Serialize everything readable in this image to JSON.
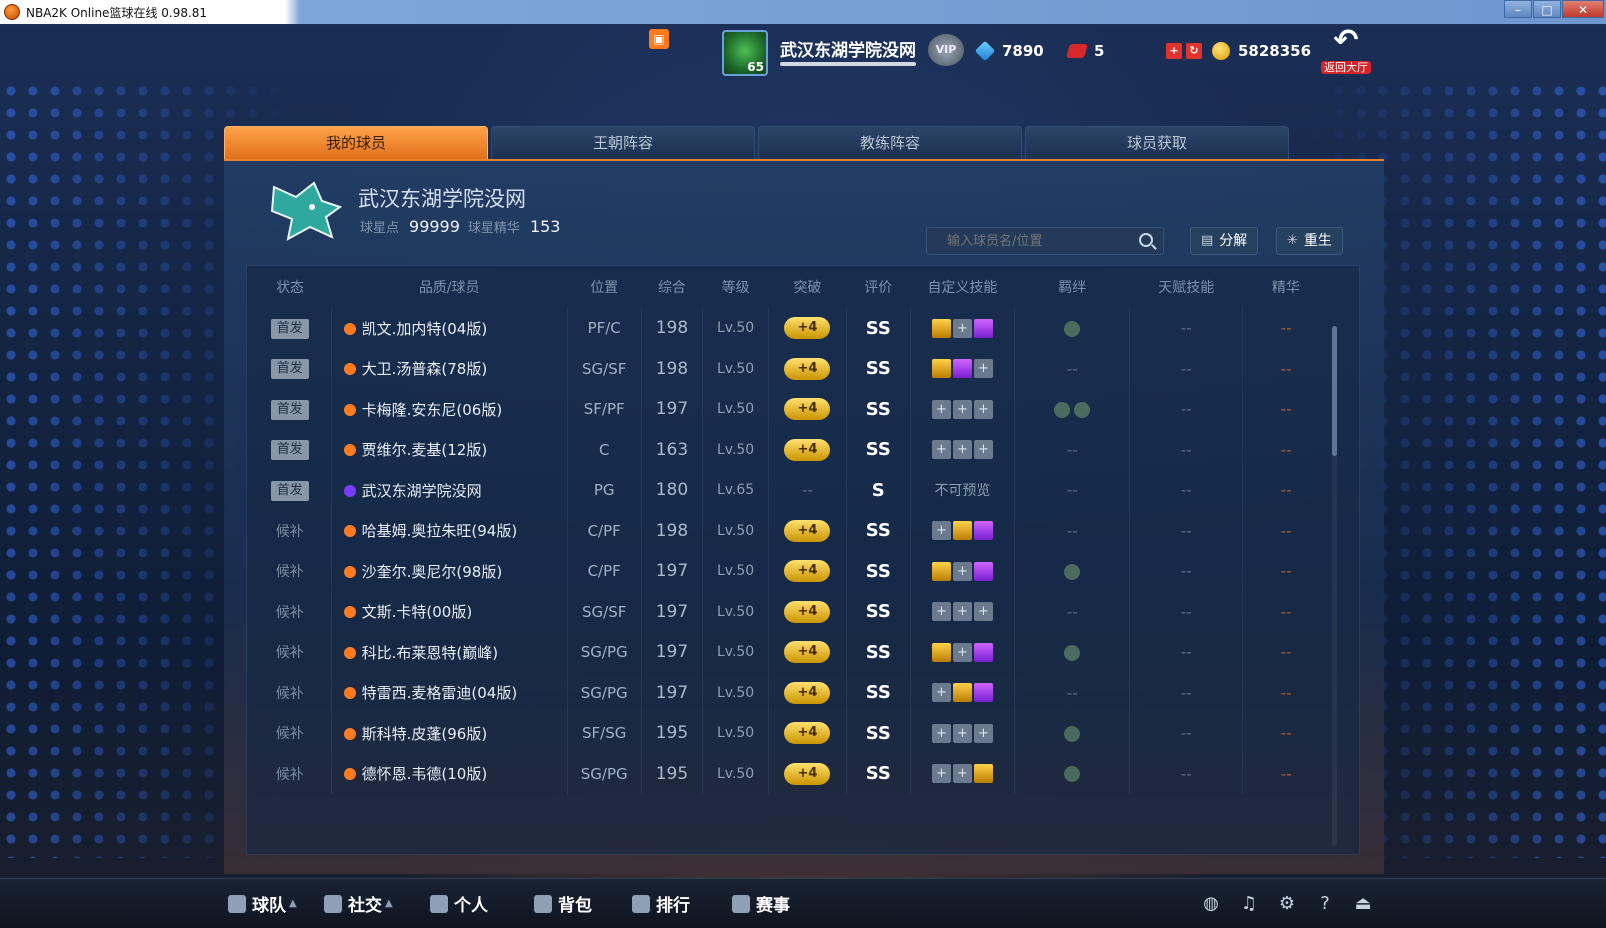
{
  "window": {
    "title": "NBA2K Online篮球在线 0.98.81"
  },
  "header": {
    "avatar_level": "65",
    "username": "武汉东湖学院没网",
    "vip_label": "VIP",
    "diamonds": "7890",
    "tickets": "5",
    "coins": "5828356",
    "back_label": "返回大厅"
  },
  "tabs": [
    "我的球员",
    "王朝阵容",
    "教练阵容",
    "球员获取"
  ],
  "team": {
    "name": "武汉东湖学院没网",
    "star_points_label": "球星点",
    "star_points": "99999",
    "essence_label": "球星精华",
    "essence": "153"
  },
  "search": {
    "placeholder": "输入球员名/位置"
  },
  "buttons": {
    "decompose": "分解",
    "rebirth": "重生"
  },
  "table": {
    "headers": [
      "状态",
      "品质/球员",
      "位置",
      "综合",
      "等级",
      "突破",
      "评价",
      "自定义技能",
      "羁绊",
      "天赋技能",
      "精华"
    ],
    "rows": [
      {
        "status": "首发",
        "name": "凯文.加内特(04版)",
        "pos": "PF/C",
        "ovr": "198",
        "lv": "Lv.50",
        "bt": "+4",
        "grade": "SS"
      },
      {
        "status": "首发",
        "name": "大卫.汤普森(78版)",
        "pos": "SG/SF",
        "ovr": "198",
        "lv": "Lv.50",
        "bt": "+4",
        "grade": "SS"
      },
      {
        "status": "首发",
        "name": "卡梅隆.安东尼(06版)",
        "pos": "SF/PF",
        "ovr": "197",
        "lv": "Lv.50",
        "bt": "+4",
        "grade": "SS"
      },
      {
        "status": "首发",
        "name": "贾维尔.麦基(12版)",
        "pos": "C",
        "ovr": "163",
        "lv": "Lv.50",
        "bt": "+4",
        "grade": "SS"
      },
      {
        "status": "首发",
        "name": "武汉东湖学院没网",
        "pos": "PG",
        "ovr": "180",
        "lv": "Lv.65",
        "bt": "--",
        "grade": "S",
        "skills_text": "不可预览"
      },
      {
        "status": "候补",
        "name": "哈基姆.奥拉朱旺(94版)",
        "pos": "C/PF",
        "ovr": "198",
        "lv": "Lv.50",
        "bt": "+4",
        "grade": "SS"
      },
      {
        "status": "候补",
        "name": "沙奎尔.奥尼尔(98版)",
        "pos": "C/PF",
        "ovr": "197",
        "lv": "Lv.50",
        "bt": "+4",
        "grade": "SS"
      },
      {
        "status": "候补",
        "name": "文斯.卡特(00版)",
        "pos": "SG/SF",
        "ovr": "197",
        "lv": "Lv.50",
        "bt": "+4",
        "grade": "SS"
      },
      {
        "status": "候补",
        "name": "科比.布莱恩特(巅峰)",
        "pos": "SG/PG",
        "ovr": "197",
        "lv": "Lv.50",
        "bt": "+4",
        "grade": "SS"
      },
      {
        "status": "候补",
        "name": "特雷西.麦格雷迪(04版)",
        "pos": "SG/PG",
        "ovr": "197",
        "lv": "Lv.50",
        "bt": "+4",
        "grade": "SS"
      },
      {
        "status": "候补",
        "name": "斯科特.皮蓬(96版)",
        "pos": "SF/SG",
        "ovr": "195",
        "lv": "Lv.50",
        "bt": "+4",
        "grade": "SS"
      },
      {
        "status": "候补",
        "name": "德怀恩.韦德(10版)",
        "pos": "SG/PG",
        "ovr": "195",
        "lv": "Lv.50",
        "bt": "+4",
        "grade": "SS"
      }
    ]
  },
  "bottom_nav": [
    "球队",
    "社交",
    "个人",
    "背包",
    "排行",
    "赛事"
  ],
  "colors": {
    "accent": "#e5812e",
    "panel": "#1d3150",
    "gold": "#ffd24a",
    "purple": "#7a3cff"
  }
}
